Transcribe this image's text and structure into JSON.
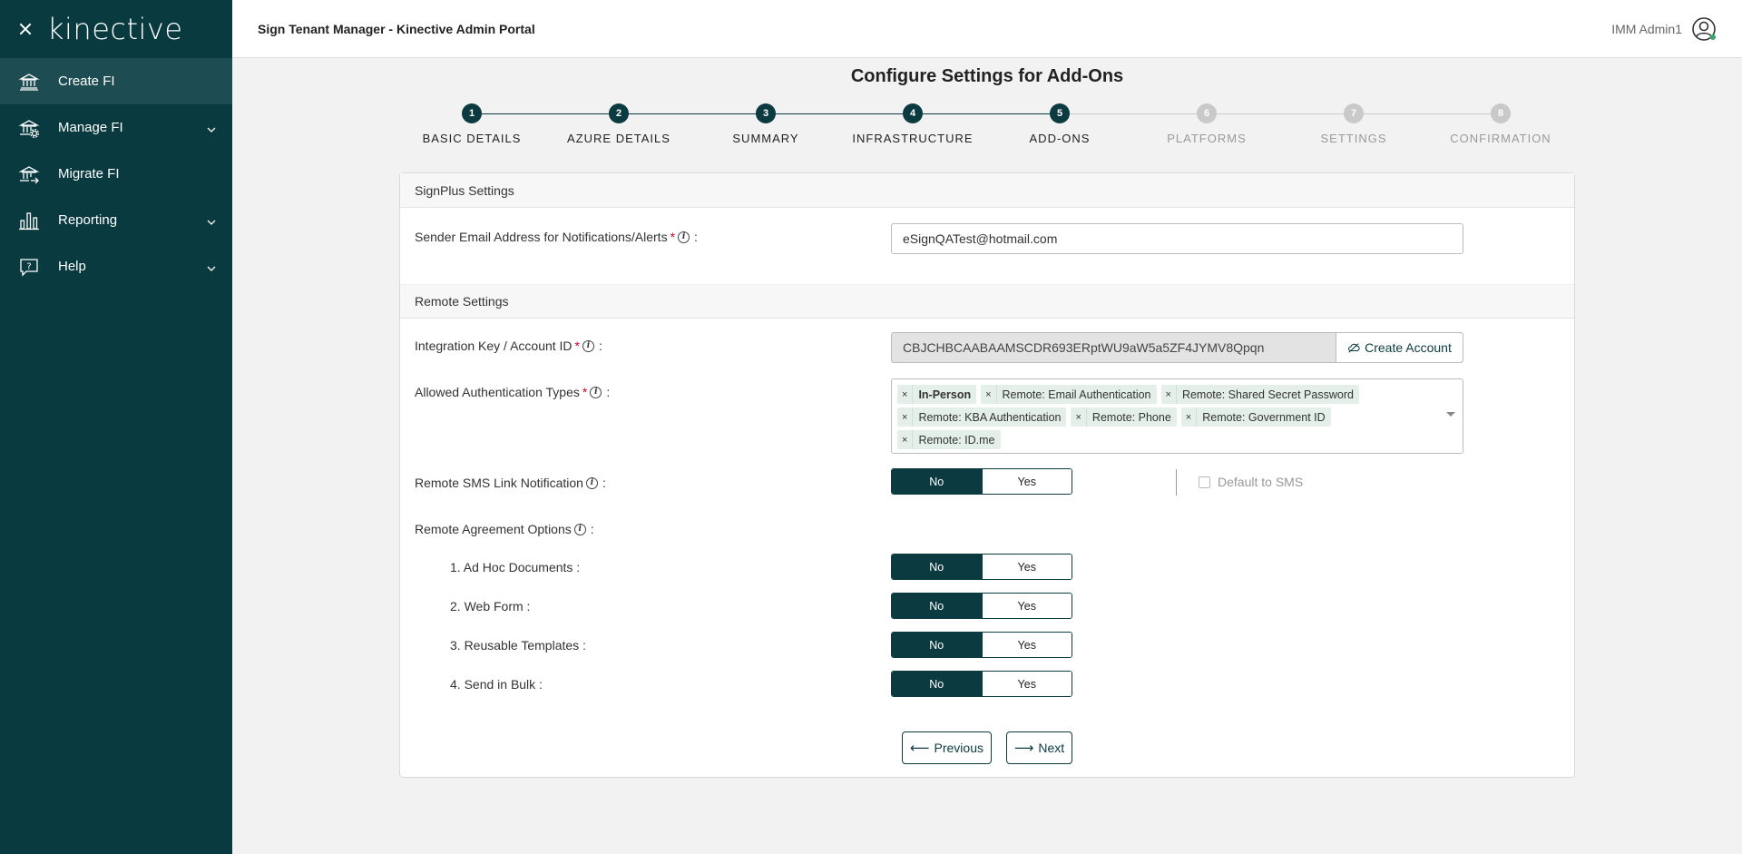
{
  "sidebar": {
    "logo": "kinective",
    "items": [
      {
        "label": "Create FI",
        "icon": "bank-icon",
        "active": true,
        "expandable": false
      },
      {
        "label": "Manage FI",
        "icon": "bank-settings-icon",
        "active": false,
        "expandable": true
      },
      {
        "label": "Migrate FI",
        "icon": "bank-migrate-icon",
        "active": false,
        "expandable": false
      },
      {
        "label": "Reporting",
        "icon": "bar-chart-icon",
        "active": false,
        "expandable": true
      },
      {
        "label": "Help",
        "icon": "help-icon",
        "active": false,
        "expandable": true
      }
    ]
  },
  "header": {
    "title": "Sign Tenant Manager - Kinective Admin Portal",
    "user": "IMM Admin1"
  },
  "page": {
    "title": "Configure Settings for Add-Ons"
  },
  "stepper": {
    "steps": [
      {
        "num": "1",
        "label": "BASIC DETAILS",
        "done": true
      },
      {
        "num": "2",
        "label": "AZURE DETAILS",
        "done": true
      },
      {
        "num": "3",
        "label": "SUMMARY",
        "done": true
      },
      {
        "num": "4",
        "label": "INFRASTRUCTURE",
        "done": true
      },
      {
        "num": "5",
        "label": "ADD-ONS",
        "done": true
      },
      {
        "num": "6",
        "label": "PLATFORMS",
        "done": false
      },
      {
        "num": "7",
        "label": "SETTINGS",
        "done": false
      },
      {
        "num": "8",
        "label": "CONFIRMATION",
        "done": false
      }
    ]
  },
  "signplus": {
    "section_title": "SignPlus Settings",
    "sender_label": "Sender Email Address for Notifications/Alerts",
    "sender_value": "eSignQATest@hotmail.com"
  },
  "remote": {
    "section_title": "Remote Settings",
    "key_label": "Integration Key / Account ID",
    "key_value": "CBJCHBCAABAAMSCDR693ERptWU9aW5a5ZF4JYMV8Qpqn",
    "create_account": "Create Account",
    "auth_label": "Allowed Authentication Types",
    "auth_types": [
      {
        "label": "In-Person",
        "bold": true
      },
      {
        "label": "Remote: Email Authentication",
        "bold": false
      },
      {
        "label": "Remote: Shared Secret Password",
        "bold": false
      },
      {
        "label": "Remote: KBA Authentication",
        "bold": false
      },
      {
        "label": "Remote: Phone",
        "bold": false
      },
      {
        "label": "Remote: Government ID",
        "bold": false
      },
      {
        "label": "Remote: ID.me",
        "bold": false
      }
    ],
    "sms_label": "Remote SMS Link Notification",
    "default_sms": "Default to SMS",
    "agreement_label": "Remote Agreement Options",
    "agreement_options": [
      {
        "label": "1. Ad Hoc Documents :"
      },
      {
        "label": "2. Web Form :"
      },
      {
        "label": "3. Reusable Templates :"
      },
      {
        "label": "4. Send in Bulk :"
      }
    ],
    "no": "No",
    "yes": "Yes"
  },
  "buttons": {
    "previous": "Previous",
    "next": "Next"
  },
  "colors": {
    "sidebar": "#083a3f",
    "accent": "#0b3b40",
    "step_inactive": "#c9c9c9",
    "chip": "#e4efe9",
    "required": "#d0021b"
  }
}
